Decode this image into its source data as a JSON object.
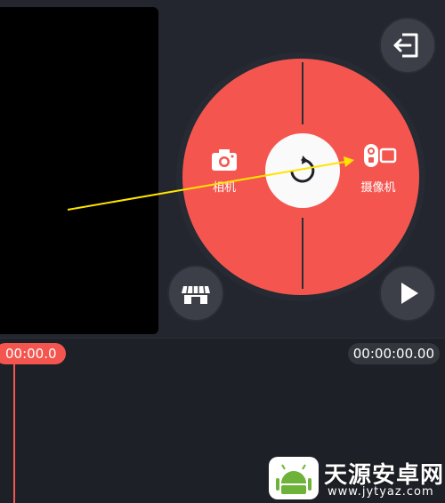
{
  "camera": {
    "modes": {
      "photo_label": "相机",
      "video_label": "摄像机"
    },
    "accent_color": "#f4564f"
  },
  "timeline": {
    "current_time": "00:00.0",
    "total_time": "00:00:00.00"
  },
  "icons": {
    "exit": "exit-icon",
    "store": "store-icon",
    "play": "play-icon",
    "photo": "camera-icon",
    "video": "video-camera-icon",
    "center": "rotate-icon"
  },
  "watermark": {
    "title": "天源安卓网",
    "url": "www.jytyaz.com"
  }
}
